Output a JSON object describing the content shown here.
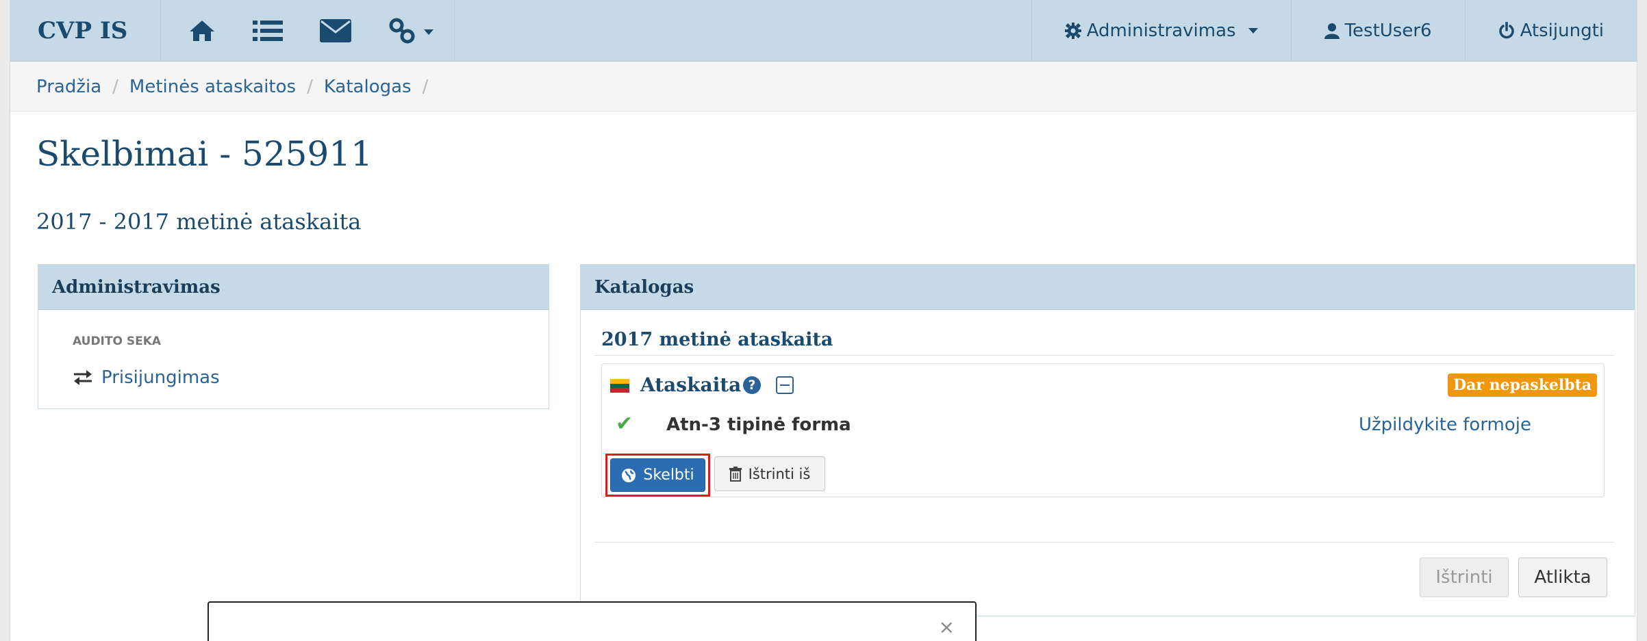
{
  "navbar": {
    "brand": "CVP IS",
    "icons": [
      "home-icon",
      "list-icon",
      "envelope-icon",
      "link-icon"
    ],
    "admin_label": "Administravimas",
    "user_label": "TestUser6",
    "logout_label": "Atsijungti"
  },
  "breadcrumb": {
    "items": [
      "Pradžia",
      "Metinės ataskaitos",
      "Katalogas"
    ]
  },
  "page": {
    "title": "Skelbimai - 525911",
    "subtitle": "2017 - 2017 metinė ataskaita"
  },
  "admin_panel": {
    "title": "Administravimas",
    "section_label": "AUDITO SEKA",
    "link_label": "Prisijungimas"
  },
  "catalog_panel": {
    "title": "Katalogas",
    "subheading": "2017 metinė ataskaita",
    "report": {
      "title": "Ataskaita",
      "help_symbol": "?",
      "status_badge": "Dar nepaskelbta",
      "form_name": "Atn-3 tipinė forma",
      "fill_link": "Užpildykite formoje"
    },
    "publish_label": "Skelbti",
    "delete_from_label": "Ištrinti iš",
    "delete_label": "Ištrinti",
    "done_label": "Atlikta"
  },
  "modal": {
    "close_symbol": "×"
  },
  "colors": {
    "navbar_bg": "#c5dae6",
    "link": "#2a6496",
    "primary_button": "#2a6db3",
    "badge_warning": "#f0960f",
    "highlight_border": "#e21a1a",
    "check": "#4aaa4a"
  }
}
